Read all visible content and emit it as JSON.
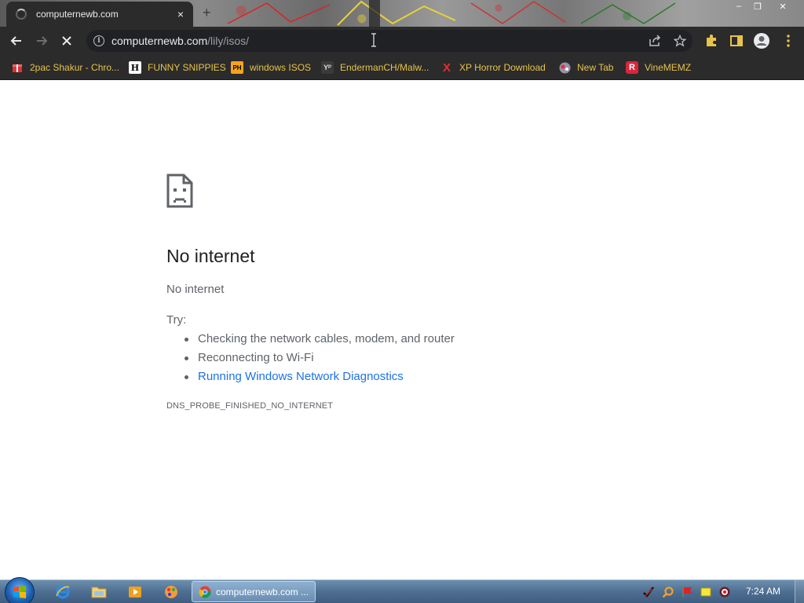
{
  "browser": {
    "tab": {
      "title": "computernewb.com",
      "new_tab_glyph": "+",
      "close_glyph": "×"
    },
    "window_controls": {
      "minimize": "–",
      "restore": "❐",
      "close": "✕"
    },
    "omnibox": {
      "host": "computernewb.com",
      "path": "/lily/isos/",
      "info_glyph": "i"
    },
    "bookmarks": [
      {
        "label": "2pac Shakur - Chro...",
        "icon": "gift-icon"
      },
      {
        "label": "FUNNY SNIPPIES",
        "icon": "h-icon",
        "glyph": "H"
      },
      {
        "label": "windows ISOS",
        "icon": "ph-icon",
        "glyph": "PH"
      },
      {
        "label": "EndermanCH/Malw...",
        "icon": "yp-icon",
        "glyph": "Yᴾ"
      },
      {
        "label": "XP Horror Download",
        "icon": "x-icon",
        "glyph": "X"
      },
      {
        "label": "New Tab",
        "icon": "globe-icon"
      },
      {
        "label": "VineMEMZ",
        "icon": "r-icon",
        "glyph": "R"
      }
    ]
  },
  "error_page": {
    "title": "No internet",
    "subtitle": "No internet",
    "try_label": "Try:",
    "suggestions": [
      "Checking the network cables, modem, and router",
      "Reconnecting to Wi-Fi"
    ],
    "diagnostics_link": "Running Windows Network Diagnostics",
    "error_code": "DNS_PROBE_FINISHED_NO_INTERNET"
  },
  "taskbar": {
    "task_label": "computernewb.com ...",
    "clock": "7:24 AM"
  },
  "colors": {
    "chrome_dark": "#2b2b2b",
    "bookmark_text": "#e8c24a",
    "link": "#1a73e8",
    "taskbar": "#4f6f92"
  }
}
